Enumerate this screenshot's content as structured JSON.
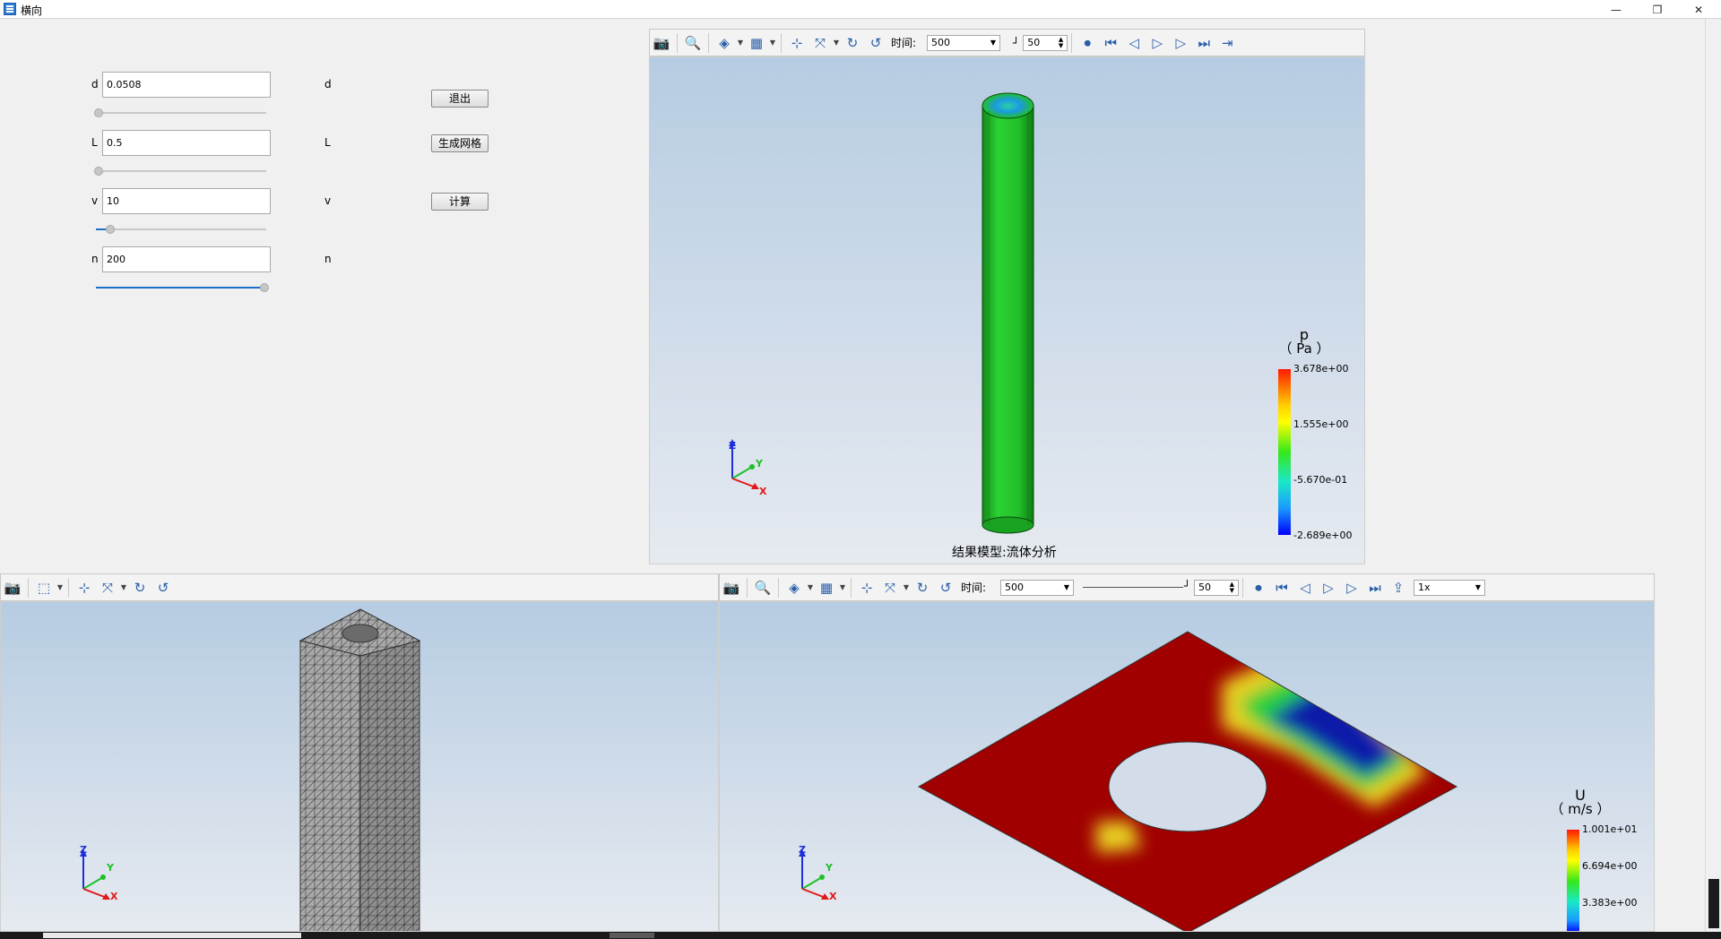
{
  "window": {
    "title": "横向",
    "minimize": "—",
    "restore": "❐",
    "close": "✕"
  },
  "controls": [
    {
      "label": "d",
      "value": "0.0508",
      "unit_label": "d",
      "slider_fraction": 0.0
    },
    {
      "label": "L",
      "value": "0.5",
      "unit_label": "L",
      "slider_fraction": 0.0
    },
    {
      "label": "v",
      "value": "10",
      "unit_label": "v",
      "slider_fraction": 0.08
    },
    {
      "label": "n",
      "value": "200",
      "unit_label": "n",
      "slider_fraction": 1.0
    }
  ],
  "buttons": {
    "exit": "退出",
    "mesh": "生成网格",
    "compute": "计算"
  },
  "top_view": {
    "time_label": "时间:",
    "time_value": "500",
    "step_value": "50",
    "caption": "结果模型:流体分析",
    "legend": {
      "variable": "p",
      "unit": "（ Pa ）",
      "values": [
        "3.678e+00",
        "1.555e+00",
        "-5.670e-01",
        "-2.689e+00"
      ]
    }
  },
  "bottom_right_view": {
    "time_label": "时间:",
    "time_value": "500",
    "step_value": "50",
    "speed_value": "1x",
    "legend": {
      "variable": "U",
      "unit": "（ m/s ）",
      "values": [
        "1.001e+01",
        "6.694e+00",
        "3.383e+00"
      ]
    }
  },
  "axes": {
    "x": "X",
    "y": "Y",
    "z": "Z"
  },
  "colors": {
    "accent": "#1e6fc9",
    "pipe_green": "#22c02a",
    "field_red": "#a00000",
    "field_blue": "#0a1aa8"
  }
}
